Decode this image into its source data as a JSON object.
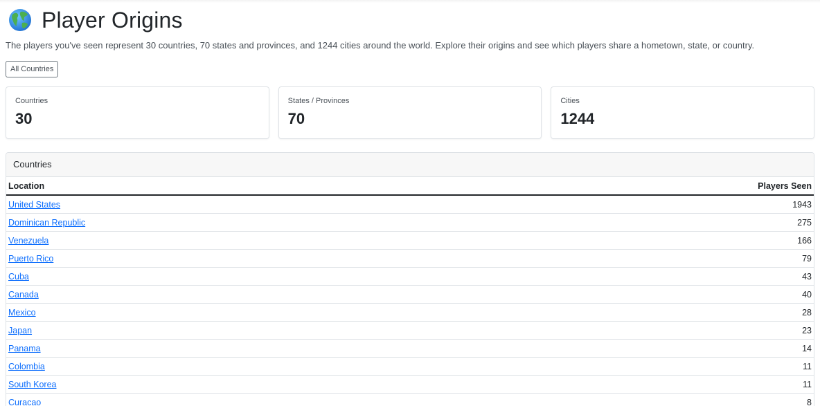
{
  "header": {
    "title": "Player Origins",
    "icon": "globe-icon",
    "intro": "The players you've seen represent 30 countries, 70 states and provinces, and 1244 cities around the world. Explore their origins and see which players share a hometown, state, or country."
  },
  "filter": {
    "button_label": "All Countries"
  },
  "stats": [
    {
      "label": "Countries",
      "value": "30"
    },
    {
      "label": "States / Provinces",
      "value": "70"
    },
    {
      "label": "Cities",
      "value": "1244"
    }
  ],
  "table": {
    "card_title": "Countries",
    "columns": {
      "location": "Location",
      "players": "Players Seen"
    },
    "rows": [
      {
        "location": "United States",
        "players": "1943"
      },
      {
        "location": "Dominican Republic",
        "players": "275"
      },
      {
        "location": "Venezuela",
        "players": "166"
      },
      {
        "location": "Puerto Rico",
        "players": "79"
      },
      {
        "location": "Cuba",
        "players": "43"
      },
      {
        "location": "Canada",
        "players": "40"
      },
      {
        "location": "Mexico",
        "players": "28"
      },
      {
        "location": "Japan",
        "players": "23"
      },
      {
        "location": "Panama",
        "players": "14"
      },
      {
        "location": "Colombia",
        "players": "11"
      },
      {
        "location": "South Korea",
        "players": "11"
      },
      {
        "location": "Curacao",
        "players": "8"
      }
    ]
  },
  "colors": {
    "link": "#0d6efd",
    "text": "#212529",
    "muted": "#495057",
    "border": "#dee2e6"
  }
}
